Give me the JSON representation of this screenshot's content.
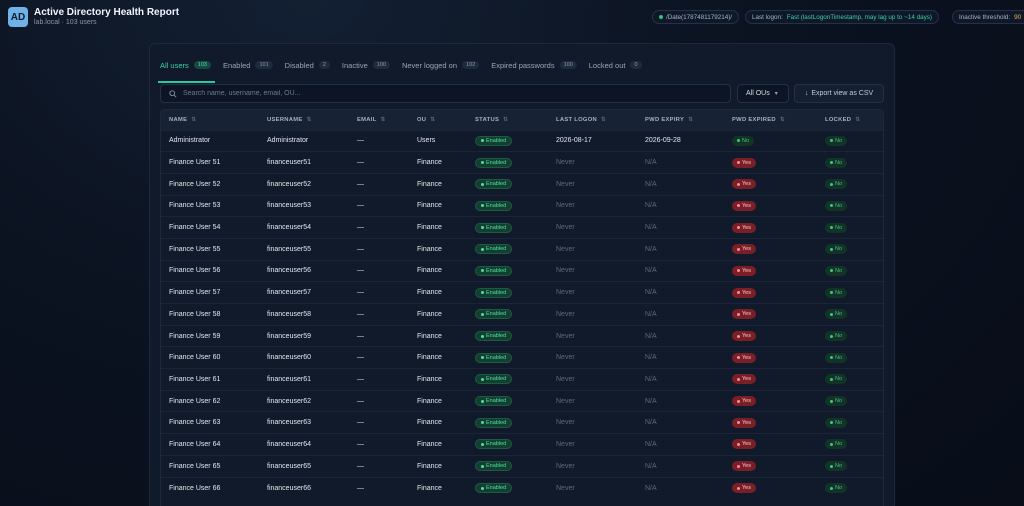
{
  "header": {
    "logo": "AD",
    "title": "Active Directory Health Report",
    "subtitle": "lab.local · 103 users",
    "chip_date": "/Date(1787481179214)/",
    "chip_logon_label": "Last logon:",
    "chip_logon_value": "Fast (lastLogonTimestamp, may lag up to ~14 days)",
    "chip_threshold_label": "Inactive threshold:",
    "chip_threshold_value": "90"
  },
  "tabs": [
    {
      "label": "All users",
      "count": "103"
    },
    {
      "label": "Enabled",
      "count": "101"
    },
    {
      "label": "Disabled",
      "count": "2"
    },
    {
      "label": "Inactive",
      "count": "100"
    },
    {
      "label": "Never logged on",
      "count": "102"
    },
    {
      "label": "Expired passwords",
      "count": "100"
    },
    {
      "label": "Locked out",
      "count": "0"
    }
  ],
  "toolbar": {
    "search_placeholder": "Search name, username, email, OU...",
    "ou_select": "All OUs",
    "export_label": "Export view as CSV"
  },
  "table": {
    "columns": [
      "NAME",
      "USERNAME",
      "EMAIL",
      "OU",
      "STATUS",
      "LAST LOGON",
      "PWD EXPIRY",
      "PWD EXPIRED",
      "LOCKED"
    ],
    "rows": [
      {
        "name": "Administrator",
        "username": "Administrator",
        "email": "—",
        "ou": "Users",
        "status": "Enabled",
        "last_logon": "2026-08-17",
        "pwd_expiry": "2026-09-28",
        "pwd_expired": "No",
        "locked": "No"
      },
      {
        "name": "Finance User 51",
        "username": "financeuser51",
        "email": "—",
        "ou": "Finance",
        "status": "Enabled",
        "last_logon": "Never",
        "pwd_expiry": "N/A",
        "pwd_expired": "Yes",
        "locked": "No"
      },
      {
        "name": "Finance User 52",
        "username": "financeuser52",
        "email": "—",
        "ou": "Finance",
        "status": "Enabled",
        "last_logon": "Never",
        "pwd_expiry": "N/A",
        "pwd_expired": "Yes",
        "locked": "No"
      },
      {
        "name": "Finance User 53",
        "username": "financeuser53",
        "email": "—",
        "ou": "Finance",
        "status": "Enabled",
        "last_logon": "Never",
        "pwd_expiry": "N/A",
        "pwd_expired": "Yes",
        "locked": "No"
      },
      {
        "name": "Finance User 54",
        "username": "financeuser54",
        "email": "—",
        "ou": "Finance",
        "status": "Enabled",
        "last_logon": "Never",
        "pwd_expiry": "N/A",
        "pwd_expired": "Yes",
        "locked": "No"
      },
      {
        "name": "Finance User 55",
        "username": "financeuser55",
        "email": "—",
        "ou": "Finance",
        "status": "Enabled",
        "last_logon": "Never",
        "pwd_expiry": "N/A",
        "pwd_expired": "Yes",
        "locked": "No"
      },
      {
        "name": "Finance User 56",
        "username": "financeuser56",
        "email": "—",
        "ou": "Finance",
        "status": "Enabled",
        "last_logon": "Never",
        "pwd_expiry": "N/A",
        "pwd_expired": "Yes",
        "locked": "No"
      },
      {
        "name": "Finance User 57",
        "username": "financeuser57",
        "email": "—",
        "ou": "Finance",
        "status": "Enabled",
        "last_logon": "Never",
        "pwd_expiry": "N/A",
        "pwd_expired": "Yes",
        "locked": "No"
      },
      {
        "name": "Finance User 58",
        "username": "financeuser58",
        "email": "—",
        "ou": "Finance",
        "status": "Enabled",
        "last_logon": "Never",
        "pwd_expiry": "N/A",
        "pwd_expired": "Yes",
        "locked": "No"
      },
      {
        "name": "Finance User 59",
        "username": "financeuser59",
        "email": "—",
        "ou": "Finance",
        "status": "Enabled",
        "last_logon": "Never",
        "pwd_expiry": "N/A",
        "pwd_expired": "Yes",
        "locked": "No"
      },
      {
        "name": "Finance User 60",
        "username": "financeuser60",
        "email": "—",
        "ou": "Finance",
        "status": "Enabled",
        "last_logon": "Never",
        "pwd_expiry": "N/A",
        "pwd_expired": "Yes",
        "locked": "No"
      },
      {
        "name": "Finance User 61",
        "username": "financeuser61",
        "email": "—",
        "ou": "Finance",
        "status": "Enabled",
        "last_logon": "Never",
        "pwd_expiry": "N/A",
        "pwd_expired": "Yes",
        "locked": "No"
      },
      {
        "name": "Finance User 62",
        "username": "financeuser62",
        "email": "—",
        "ou": "Finance",
        "status": "Enabled",
        "last_logon": "Never",
        "pwd_expiry": "N/A",
        "pwd_expired": "Yes",
        "locked": "No"
      },
      {
        "name": "Finance User 63",
        "username": "financeuser63",
        "email": "—",
        "ou": "Finance",
        "status": "Enabled",
        "last_logon": "Never",
        "pwd_expiry": "N/A",
        "pwd_expired": "Yes",
        "locked": "No"
      },
      {
        "name": "Finance User 64",
        "username": "financeuser64",
        "email": "—",
        "ou": "Finance",
        "status": "Enabled",
        "last_logon": "Never",
        "pwd_expiry": "N/A",
        "pwd_expired": "Yes",
        "locked": "No"
      },
      {
        "name": "Finance User 65",
        "username": "financeuser65",
        "email": "—",
        "ou": "Finance",
        "status": "Enabled",
        "last_logon": "Never",
        "pwd_expiry": "N/A",
        "pwd_expired": "Yes",
        "locked": "No"
      },
      {
        "name": "Finance User 66",
        "username": "financeuser66",
        "email": "—",
        "ou": "Finance",
        "status": "Enabled",
        "last_logon": "Never",
        "pwd_expiry": "N/A",
        "pwd_expired": "Yes",
        "locked": "No"
      }
    ]
  }
}
